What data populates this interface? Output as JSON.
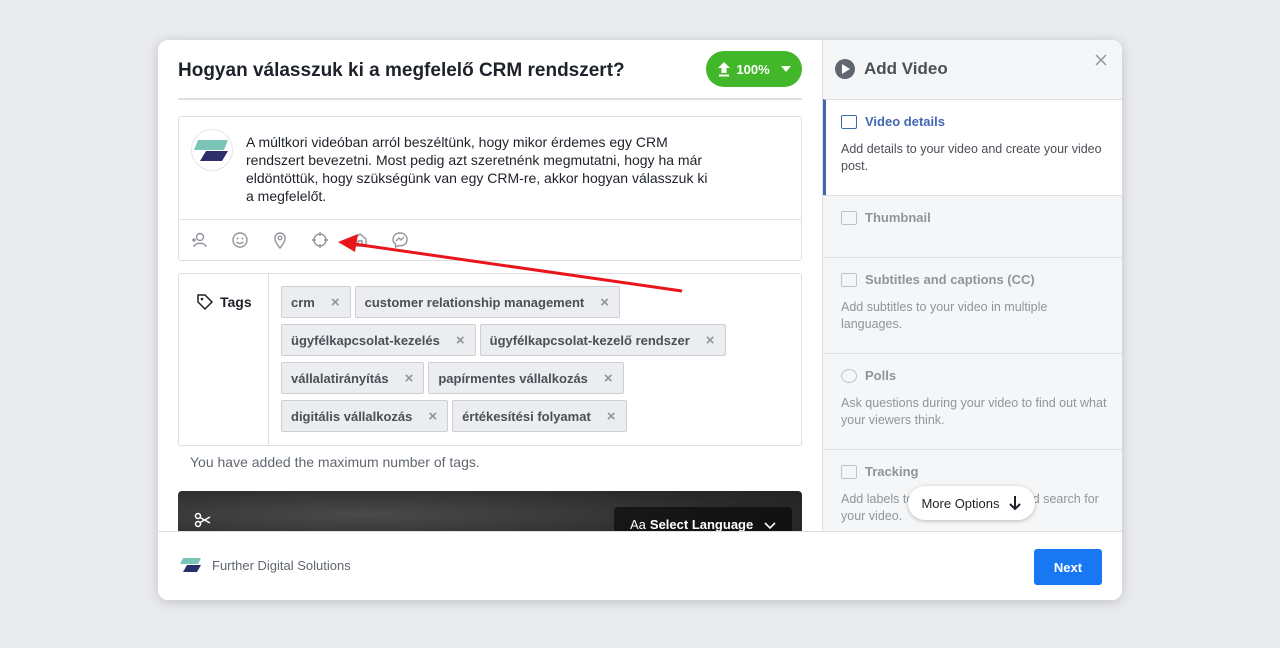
{
  "post": {
    "title": "Hogyan válasszuk ki a megfelelő CRM rendszert?",
    "upload_progress": "100%",
    "text": "A múltkori videóban arról beszéltünk, hogy mikor érdemes egy CRM rendszert bevezetni. Most pedig azt szeretnénk megmutatni, hogy ha már eldöntöttük, hogy szükségünk van egy CRM-re, akkor hogyan válasszuk ki a megfelelőt.",
    "icons": [
      "tag-people-icon",
      "feeling-icon",
      "location-icon",
      "crosshair-icon",
      "sponsor-icon",
      "messenger-icon"
    ]
  },
  "tags": {
    "label": "Tags",
    "items": [
      "crm",
      "customer relationship management",
      "ügyfélkapcsolat-kezelés",
      "ügyfélkapcsolat-kezelő rendszer",
      "vállalatirányítás",
      "papírmentes vállalkozás",
      "digitális vállalkozás",
      "értékesítési folyamat"
    ],
    "remove_glyph": "×",
    "max_message": "You have added the maximum number of tags."
  },
  "video": {
    "select_language_prefix": "Aa",
    "select_language": "Select Language"
  },
  "sidebar": {
    "title": "Add Video",
    "steps": [
      {
        "title": "Video details",
        "desc": "Add details to your video and create your video post.",
        "active": true
      },
      {
        "title": "Thumbnail",
        "desc": ""
      },
      {
        "title": "Subtitles and captions (CC)",
        "desc": "Add subtitles to your video in multiple languages."
      },
      {
        "title": "Polls",
        "desc": "Ask questions during your video to find out what your viewers think."
      },
      {
        "title": "Tracking",
        "desc": "Add labels to help you organize and search for your video."
      }
    ],
    "more_options": "More Options"
  },
  "footer": {
    "page_name": "Further Digital Solutions",
    "next_label": "Next"
  },
  "colors": {
    "upload_green": "#42b72a",
    "next_blue": "#1877f2",
    "active_step_blue": "#4267b2",
    "annotation_red": "#e8161b"
  }
}
